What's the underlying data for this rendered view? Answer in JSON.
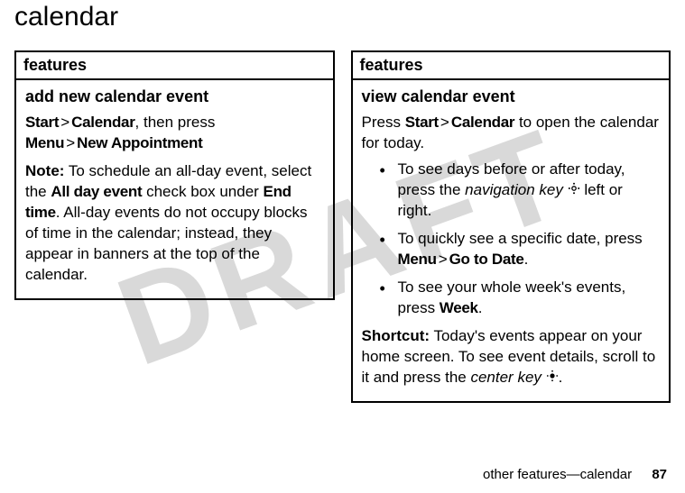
{
  "watermark": "DRAFT",
  "title": "calendar",
  "left": {
    "header": "features",
    "subhead": "add new calendar event",
    "path1a": "Start",
    "path1b": "Calendar",
    "path1c": ", then press",
    "path2a": "Menu",
    "path2b": "New Appointment",
    "note_label": "Note:",
    "note_pre": " To schedule an all-day event, select the ",
    "note_bold1": "All day event",
    "note_mid": " check box under ",
    "note_bold2": "End time",
    "note_post": ". All-day events do not occupy blocks of time in the calendar; instead, they appear in banners at the top of the calendar."
  },
  "right": {
    "header": "features",
    "subhead": "view calendar event",
    "intro_pre": "Press ",
    "intro_b1": "Start",
    "intro_b2": "Calendar",
    "intro_post": " to open the calendar for today.",
    "b1_pre": "To see days before or after today, press the ",
    "b1_it": "navigation key",
    "b1_post": " left or right.",
    "b2_pre": "To quickly see a specific date, press ",
    "b2_b1": "Menu",
    "b2_b2": "Go to Date",
    "b2_post": ".",
    "b3_pre": "To see your whole week's events, press ",
    "b3_b1": "Week",
    "b3_post": ".",
    "sc_label": "Shortcut:",
    "sc_pre": " Today's events appear on your home screen. To see event details, scroll to it and press the ",
    "sc_it": "center key",
    "sc_post": "."
  },
  "footer": {
    "text": "other features—calendar",
    "page": "87"
  },
  "gt": ">"
}
